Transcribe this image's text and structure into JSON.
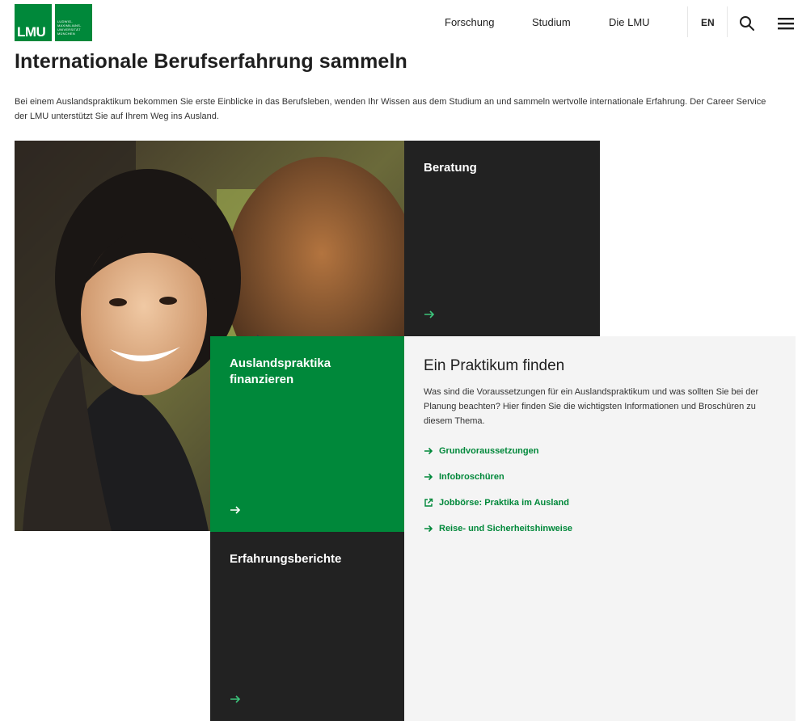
{
  "header": {
    "logo": {
      "abbrev": "LMU",
      "subtext": "LUDWIG-\nMAXIMILIANS-\nUNIVERSITÄT\nMÜNCHEN"
    },
    "nav": [
      "Forschung",
      "Studium",
      "Die LMU"
    ],
    "language": "EN",
    "icons": {
      "search": "search-icon",
      "menu": "menu-icon"
    }
  },
  "page": {
    "title": "Internationale Berufserfahrung sammeln",
    "intro": "Bei einem Auslandspraktikum bekommen Sie erste Einblicke in das Berufsleben, wenden Ihr Wissen aus dem Studium an und sammeln wertvolle internationale Erfahrung. Der Career Service der LMU unterstützt Sie auf Ihrem Weg ins Ausland."
  },
  "tiles": {
    "beratung": "Beratung",
    "finanzieren": "Auslandspraktika finanzieren",
    "berichte": "Erfahrungsberichte"
  },
  "panel": {
    "title": "Ein Praktikum finden",
    "text": "Was sind die Voraussetzungen für ein Auslandspraktikum und was sollten Sie bei der Planung beachten? Hier finden Sie die wichtigsten Informationen und Broschüren zu diesem Thema.",
    "links": [
      {
        "label": "Grundvoraussetzungen",
        "icon": "arrow-right-icon"
      },
      {
        "label": "Infobroschüren",
        "icon": "arrow-right-icon"
      },
      {
        "label": "Jobbörse: Praktika im Ausland",
        "icon": "external-link-icon"
      },
      {
        "label": "Reise- und Sicherheitshinweise",
        "icon": "arrow-right-icon"
      }
    ]
  },
  "colors": {
    "brand_green": "#00883a",
    "dark_tile": "#222222",
    "panel_bg": "#f4f4f4"
  }
}
